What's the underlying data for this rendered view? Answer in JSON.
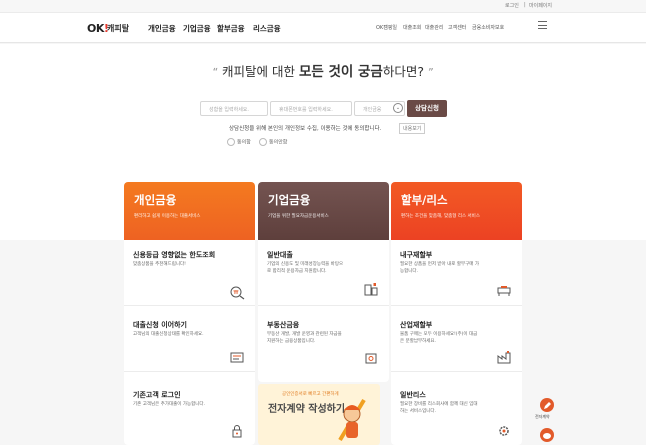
{
  "topbar": {
    "login": "로그인",
    "mypage": "마이페이지"
  },
  "header": {
    "logo_ok": "OK",
    "logo_excl": "!",
    "logo_name": "캐피탈",
    "gnb": [
      "개인금융",
      "기업금융",
      "할부금융",
      "리스금융"
    ],
    "snb": [
      "OK캠핑일",
      "대출조회",
      "대출관리",
      "고객센터",
      "금융소비자보호"
    ]
  },
  "hero": {
    "quote_open": "“",
    "headline_pre": "캐피탈에 대한 ",
    "headline_bold": "모든 것이 궁금",
    "headline_post": "하다면?",
    "quote_close": "”",
    "name_placeholder": "성함을 입력하세요.",
    "phone_placeholder": "휴대폰번호를 입력하세요.",
    "type_placeholder": "개인금융",
    "apply": "상담신청",
    "consent": "상담신청을 위해 본인의 개인정보 수집, 이용하는 것에 동의합니다.",
    "view_terms": "내용보기",
    "agree": "동의함",
    "disagree": "동의안함"
  },
  "columns": [
    {
      "title": "개인금융",
      "subtitle": "편리하고 쉽게 이용하는 대출서비스",
      "color": "#f06b1f",
      "items": [
        {
          "title": "신용등급 영향없는 한도조회",
          "desc": "맞춤상품을 추천해드립니다!",
          "icon": "search-won-icon"
        },
        {
          "title": "대출신청 이어하기",
          "desc": "고객님의 대출신청상태를 확인하세요.",
          "icon": "document-icon"
        },
        {
          "title": "기존고객 로그인",
          "desc": "기존 고객님은 추가대출이 가능합니다.",
          "icon": "lock-icon"
        }
      ]
    },
    {
      "title": "기업금융",
      "subtitle": "기업을 위한 필요자금운용서비스",
      "color": "#6a4a46",
      "items": [
        {
          "title": "일반대출",
          "desc": "기업의 신용도 및 미래성장능력을 바탕으로 합리적 운용자금 지원합니다.",
          "icon": "building-icon"
        },
        {
          "title": "부동산금융",
          "desc": "부동산 개발, 개발 운영과 관련된 자금을 지원하는 금융상품입니다.",
          "icon": "money-icon"
        }
      ]
    },
    {
      "title": "할부/리스",
      "subtitle": "편하는 조건을 맞춤해, 맞춤형 리스 서비스",
      "color": "#ef4a23",
      "items": [
        {
          "title": "내구재할부",
          "desc": "필요한 상품을 먼저 받아 내로 할부구매 가능합니다.",
          "icon": "sofa-icon"
        },
        {
          "title": "산업재할부",
          "desc": "물품 구매는 모두 이용하세요!(주)이 대금은 분할납부하세요.",
          "icon": "factory-icon"
        },
        {
          "title": "일반리스",
          "desc": "필요한 장비를 리스회사에 함께 대신 임대하는 서비스입니다.",
          "icon": "gear-icon"
        }
      ]
    }
  ],
  "promo": {
    "small": "공인인증서로 빠르고 간편하게",
    "big": "전자계약 작성하기"
  },
  "fab": {
    "label": "전자계약"
  }
}
